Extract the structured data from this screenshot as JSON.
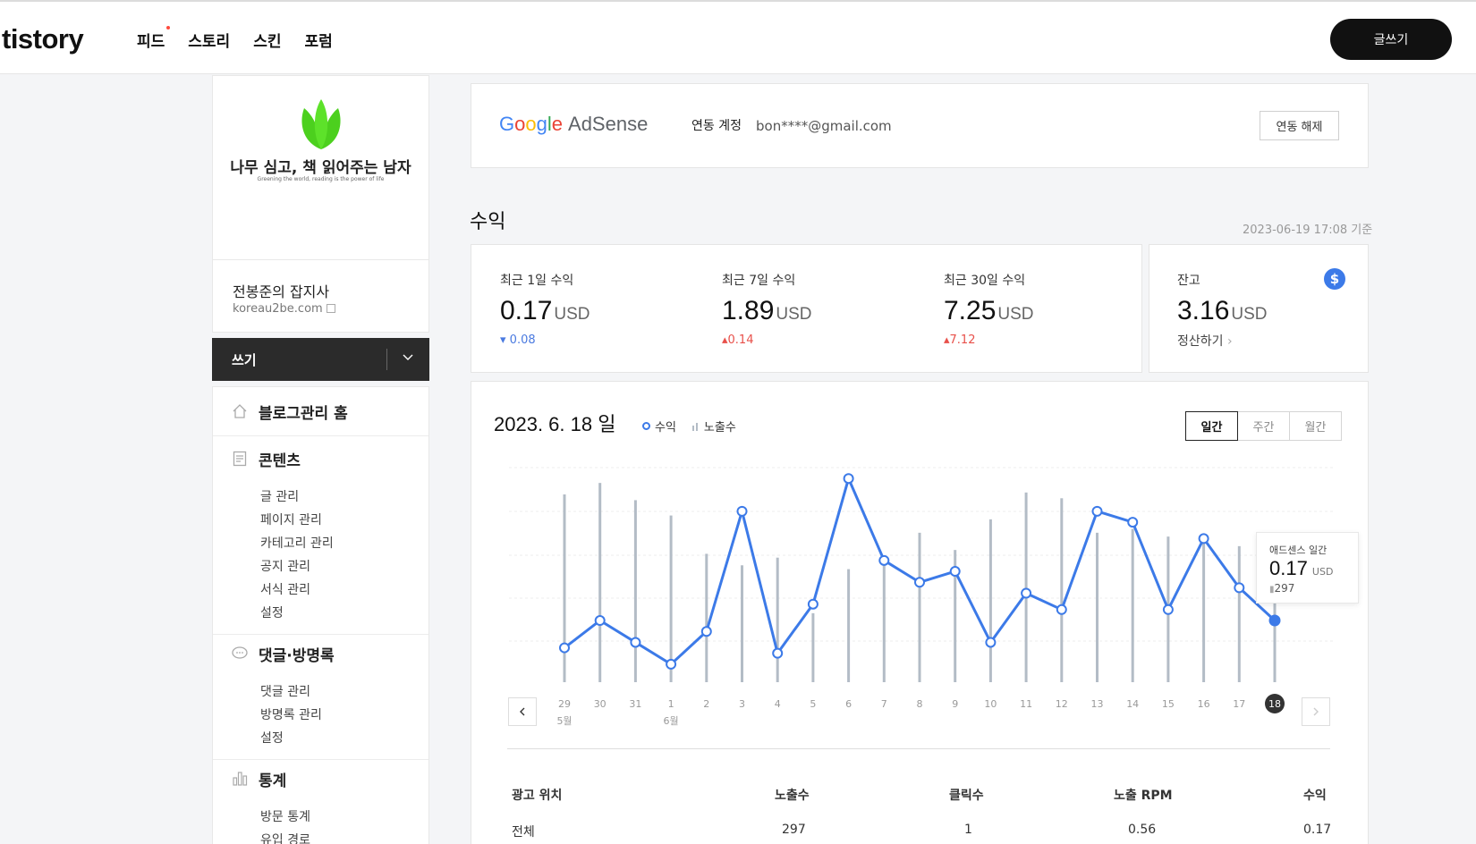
{
  "topbar": {
    "logo": "tistory",
    "nav": [
      "피드",
      "스토리",
      "스킨",
      "포럼"
    ],
    "write_label": "글쓰기"
  },
  "blog": {
    "title": "나무 심고, 책 읽어주는 남자",
    "subtitle": "Greening the world, reading is the power of life",
    "owner": "전봉준의 잡지사",
    "url": "koreau2be.com",
    "write_bar_label": "쓰기"
  },
  "menu": {
    "home": "블로그관리 홈",
    "contents": {
      "label": "콘텐츠",
      "items": [
        "글 관리",
        "페이지 관리",
        "카테고리 관리",
        "공지 관리",
        "서식 관리",
        "설정"
      ]
    },
    "comments": {
      "label": "댓글·방명록",
      "items": [
        "댓글 관리",
        "방명록 관리",
        "설정"
      ]
    },
    "stats": {
      "label": "통계",
      "items": [
        "방문 통계",
        "유입 경로"
      ]
    }
  },
  "adsense": {
    "logo_google": "Google",
    "logo_adsense": "AdSense",
    "linked_label": "연동 계정",
    "email": "bon****@gmail.com",
    "unlink_label": "연동 해제"
  },
  "revenue": {
    "title": "수익",
    "basis": "2023-06-19 17:08 기준",
    "stats": [
      {
        "label": "최근 1일 수익",
        "value": "0.17",
        "unit": "USD",
        "delta": "0.08",
        "direction": "down"
      },
      {
        "label": "최근 7일 수익",
        "value": "1.89",
        "unit": "USD",
        "delta": "0.14",
        "direction": "up"
      },
      {
        "label": "최근 30일 수익",
        "value": "7.25",
        "unit": "USD",
        "delta": "7.12",
        "direction": "up"
      }
    ],
    "balance": {
      "label": "잔고",
      "value": "3.16",
      "unit": "USD",
      "settle_label": "정산하기"
    }
  },
  "chart_header": {
    "date": "2023. 6. 18 일",
    "legend_revenue": "수익",
    "legend_impressions": "노출수",
    "tabs": [
      "일간",
      "주간",
      "월간"
    ],
    "active_tab": "일간"
  },
  "tooltip": {
    "title": "애드센스 일간",
    "value": "0.17",
    "unit": "USD",
    "impressions": "297"
  },
  "colors": {
    "line": "#3c7ae8",
    "bars": "#b3bcc6",
    "accent_down": "#4a7ae0",
    "accent_up": "#e8504a"
  },
  "chart_data": {
    "type": "line",
    "categories": [
      "29",
      "30",
      "31",
      "1",
      "2",
      "3",
      "4",
      "5",
      "6",
      "7",
      "8",
      "9",
      "10",
      "11",
      "12",
      "13",
      "14",
      "15",
      "16",
      "17",
      "18"
    ],
    "month_labels": [
      {
        "index": 0,
        "label": "5월"
      },
      {
        "index": 3,
        "label": "6월"
      }
    ],
    "highlight_index": 20,
    "series": [
      {
        "name": "수익",
        "type": "line",
        "values": [
          0.12,
          0.17,
          0.13,
          0.09,
          0.15,
          0.37,
          0.11,
          0.2,
          0.43,
          0.28,
          0.24,
          0.26,
          0.13,
          0.22,
          0.19,
          0.37,
          0.35,
          0.19,
          0.32,
          0.23,
          0.17
        ]
      },
      {
        "name": "노출수",
        "type": "bar",
        "values": [
          490,
          520,
          475,
          435,
          335,
          305,
          325,
          180,
          295,
          325,
          390,
          345,
          425,
          495,
          480,
          390,
          400,
          380,
          365,
          355,
          297
        ]
      }
    ]
  },
  "table": {
    "headers": [
      "광고 위치",
      "노출수",
      "클릭수",
      "노출 RPM",
      "수익"
    ],
    "rows": [
      [
        "전체",
        "297",
        "1",
        "0.56",
        "0.17"
      ]
    ]
  }
}
